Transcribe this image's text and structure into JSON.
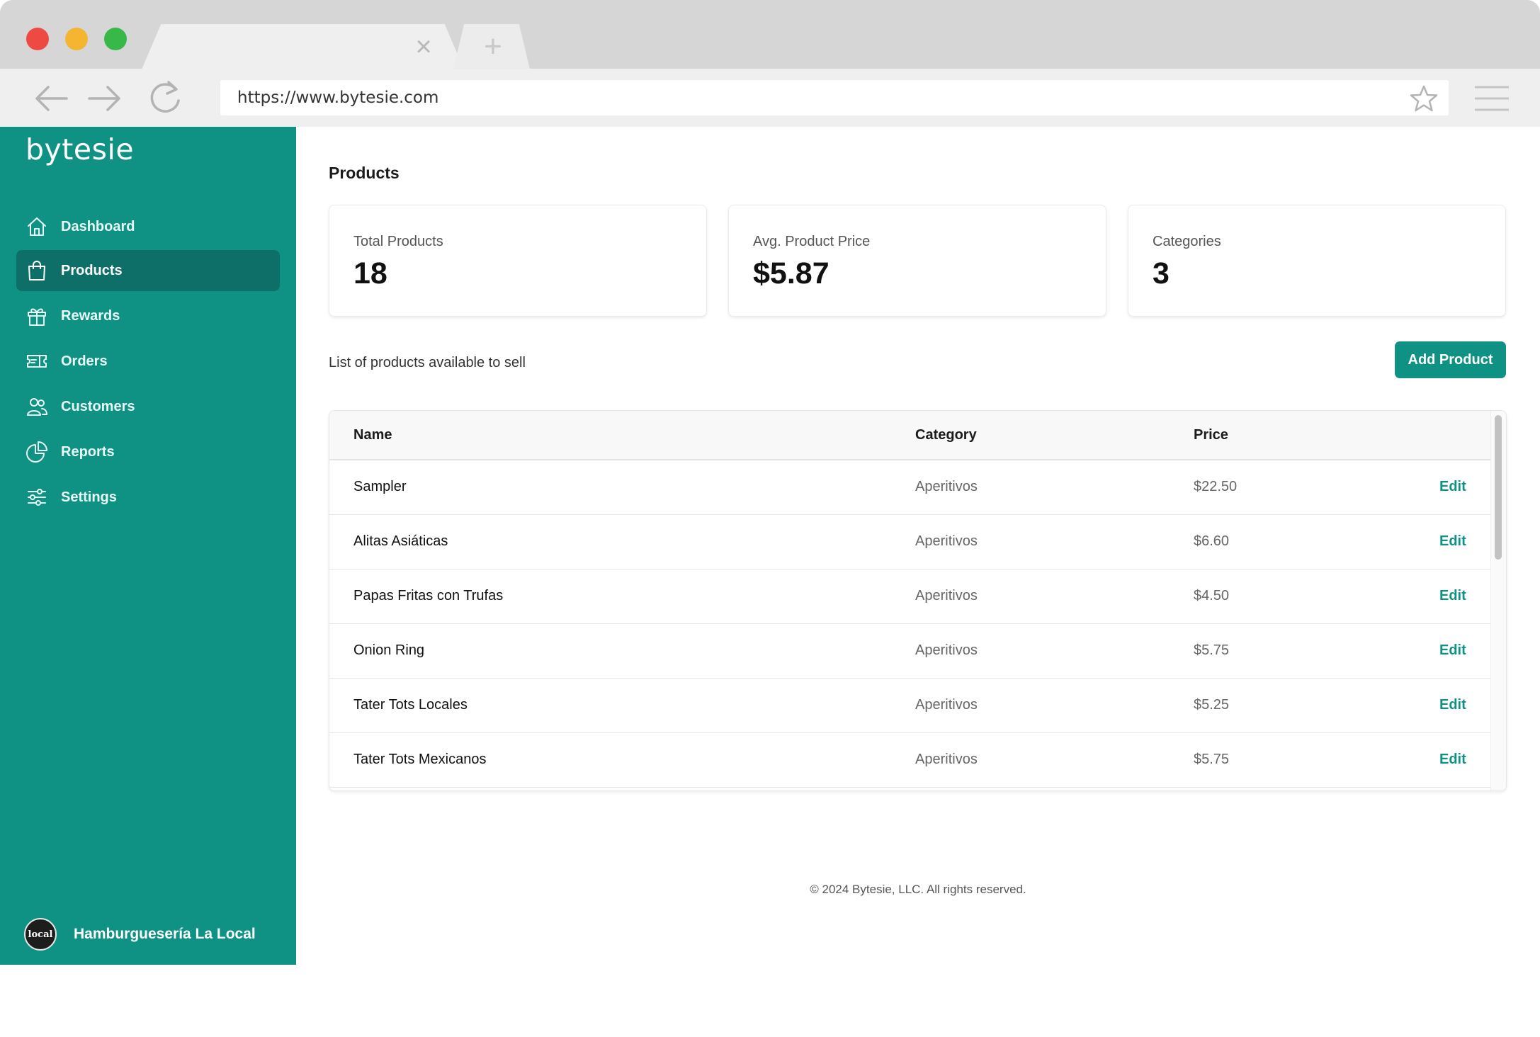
{
  "browser": {
    "url": "https://www.bytesie.com",
    "tab_close_glyph": "×",
    "new_tab_glyph": "+",
    "icons": [
      "back-arrow-icon",
      "forward-arrow-icon",
      "reload-icon",
      "bookmark-star-icon",
      "hamburger-menu-icon"
    ]
  },
  "sidebar": {
    "brand": "bytesie",
    "items": [
      {
        "label": "Dashboard",
        "icon": "home-icon",
        "active": false
      },
      {
        "label": "Products",
        "icon": "shopping-bag-icon",
        "active": true
      },
      {
        "label": "Rewards",
        "icon": "gift-icon",
        "active": false
      },
      {
        "label": "Orders",
        "icon": "ticket-icon",
        "active": false
      },
      {
        "label": "Customers",
        "icon": "users-icon",
        "active": false
      },
      {
        "label": "Reports",
        "icon": "pie-chart-icon",
        "active": false
      },
      {
        "label": "Settings",
        "icon": "sliders-icon",
        "active": false
      }
    ],
    "organization": {
      "name": "Hamburguesería La Local",
      "avatar_text": "local"
    }
  },
  "main": {
    "title": "Products",
    "stats": [
      {
        "label": "Total Products",
        "value": "18"
      },
      {
        "label": "Avg. Product Price",
        "value": "$5.87"
      },
      {
        "label": "Categories",
        "value": "3"
      }
    ],
    "list_caption": "List of products available to sell",
    "add_button": "Add Product",
    "table": {
      "headers": [
        "Name",
        "Category",
        "Price"
      ],
      "action_label": "Edit",
      "rows": [
        {
          "name": "Sampler",
          "category": "Aperitivos",
          "price": "$22.50"
        },
        {
          "name": "Alitas Asiáticas",
          "category": "Aperitivos",
          "price": "$6.60"
        },
        {
          "name": "Papas Fritas con Trufas",
          "category": "Aperitivos",
          "price": "$4.50"
        },
        {
          "name": "Onion Ring",
          "category": "Aperitivos",
          "price": "$5.75"
        },
        {
          "name": "Tater Tots Locales",
          "category": "Aperitivos",
          "price": "$5.25"
        },
        {
          "name": "Tater Tots Mexicanos",
          "category": "Aperitivos",
          "price": "$5.75"
        }
      ]
    },
    "footer": "© 2024 Bytesie, LLC. All rights reserved."
  },
  "colors": {
    "accent": "#0f9284",
    "accent_active": "#0e6f68",
    "traffic_red": "#ee4a43",
    "traffic_yellow": "#f5b530",
    "traffic_green": "#38b848"
  }
}
